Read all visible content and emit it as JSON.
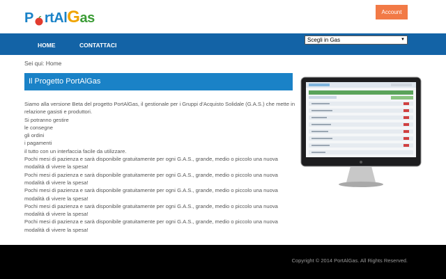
{
  "logo": {
    "text_prefix": "P",
    "text_mid": "rtAl",
    "text_suffix": "as",
    "letter_g": "G"
  },
  "header": {
    "account_label": "Account"
  },
  "nav": {
    "home": "HOME",
    "contact": "CONTATTACI"
  },
  "gas_select": {
    "value": "Scegli in Gas"
  },
  "breadcrumb": "Sei qui: Home",
  "page_title": "Il Progetto PortAlGas",
  "paragraphs": [
    "Siamo alla versione Beta del progetto PortAlGas, il gestionale per i Gruppi d'Acquisto Solidale (G.A.S.) che mette in relazione gasisti e produttori.",
    "Si potranno gestire",
    "le consegne",
    "gli ordini",
    "i pagamenti",
    "il tutto con un interfaccia facile da utilizzare.",
    "Pochi mesi di pazienza e sarà disponibile gratuitamente per ogni G.A.S., grande, medio o piccolo una nuova modalità di vivere la spesa!",
    "Pochi mesi di pazienza e sarà disponibile gratuitamente per ogni G.A.S., grande, medio o piccolo una nuova modalità di vivere la spesa!",
    "Pochi mesi di pazienza e sarà disponibile gratuitamente per ogni G.A.S., grande, medio o piccolo una nuova modalità di vivere la spesa!",
    "Pochi mesi di pazienza e sarà disponibile gratuitamente per ogni G.A.S., grande, medio o piccolo una nuova modalità di vivere la spesa!",
    "Pochi mesi di pazienza e sarà disponibile gratuitamente per ogni G.A.S., grande, medio o piccolo una nuova modalità di vivere la spesa!"
  ],
  "footer": {
    "copyright": "Copyright © 2014 PortAlGas. All Rights Reserved."
  },
  "colors": {
    "nav": "#1363a6",
    "title_bar": "#1a82c7",
    "account": "#f27a46",
    "footer": "#000000"
  }
}
